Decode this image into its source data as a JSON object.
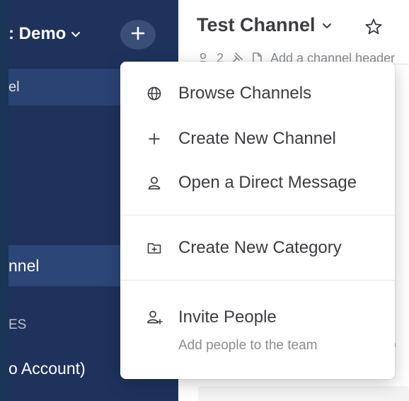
{
  "sidebar": {
    "team_name": ": Demo",
    "active_top_label": "el",
    "channel_label": "nnel",
    "category_label": "ES",
    "dm_label": "o Account)"
  },
  "header": {
    "channel_title": "Test Channel",
    "member_count": "2",
    "add_header_placeholder": "Add a channel header"
  },
  "main": {
    "bottom_text": "O"
  },
  "menu": {
    "browse_channels": "Browse Channels",
    "create_new_channel": "Create New Channel",
    "open_direct_message": "Open a Direct Message",
    "create_new_category": "Create New Category",
    "invite_people": "Invite People",
    "invite_people_sub": "Add people to the team"
  },
  "colors": {
    "sidebar_bg": "#1e325c",
    "sidebar_active_bg": "#2d4678",
    "menu_text": "#3d3c40",
    "muted_text": "#8b8d91"
  }
}
